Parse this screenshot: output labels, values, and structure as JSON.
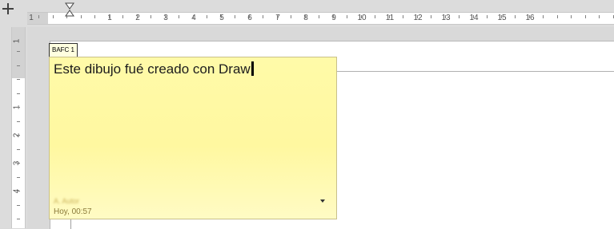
{
  "ruler": {
    "numbers": [
      "1",
      "1",
      "2",
      "3",
      "4",
      "5",
      "6",
      "7",
      "8",
      "9",
      "10",
      "11",
      "12",
      "13",
      "14",
      "15",
      "16"
    ],
    "vnumbers": [
      "1",
      "1",
      "2",
      "3",
      "4"
    ]
  },
  "comment": {
    "anchor_label": "BAFC 1",
    "text": "Este dibujo fué creado con Draw",
    "author": "A. Autor",
    "date": "Hoy, 00:57"
  }
}
